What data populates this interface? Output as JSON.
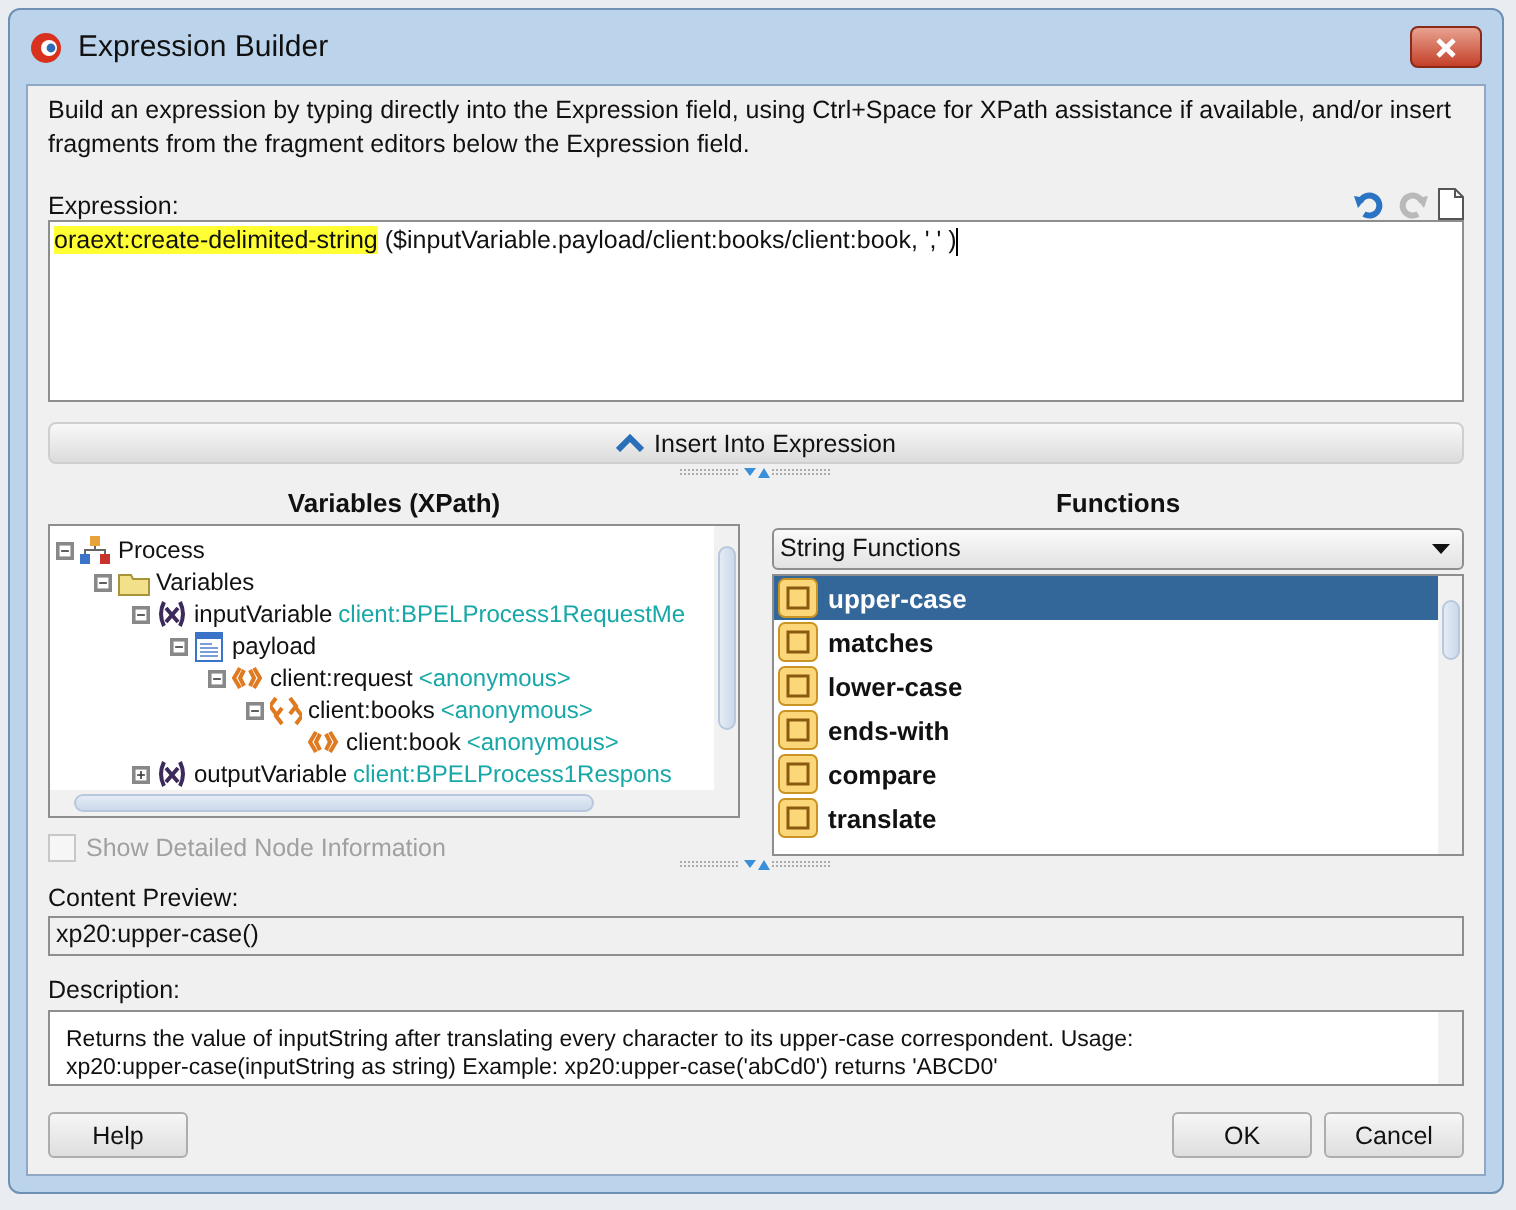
{
  "window": {
    "title": "Expression Builder"
  },
  "intro": "Build an expression by typing directly into the Expression field, using Ctrl+Space for XPath assistance if available, and/or insert fragments from the fragment editors below the Expression field.",
  "expression": {
    "label": "Expression:",
    "segments": [
      {
        "text": "oraext:create-delimited-string",
        "highlighted": true
      },
      {
        "text": " ($inputVariable.payload/client:books/client:book, ',' )",
        "highlighted": false
      }
    ]
  },
  "insert_button": "Insert Into Expression",
  "variables": {
    "title": "Variables (XPath)",
    "tree": [
      {
        "label": "Process",
        "kind": "process",
        "expanded": true,
        "children": [
          {
            "label": "Variables",
            "kind": "folder",
            "expanded": true,
            "children": [
              {
                "label": "inputVariable",
                "type": "client:BPELProcess1RequestMe",
                "kind": "variable",
                "expanded": true,
                "children": [
                  {
                    "label": "payload",
                    "kind": "part",
                    "expanded": true,
                    "children": [
                      {
                        "label": "client:request",
                        "type": "<anonymous>",
                        "kind": "element",
                        "expanded": true,
                        "children": [
                          {
                            "label": "client:books",
                            "type": "<anonymous>",
                            "kind": "elements",
                            "expanded": true,
                            "children": [
                              {
                                "label": "client:book",
                                "type": "<anonymous>",
                                "kind": "element"
                              }
                            ]
                          }
                        ]
                      }
                    ]
                  }
                ]
              },
              {
                "label": "outputVariable",
                "type": "client:BPELProcess1Respons",
                "kind": "variable",
                "expanded": false
              }
            ]
          }
        ]
      }
    ],
    "show_detail": {
      "label": "Show Detailed Node Information",
      "checked": false,
      "disabled": true
    }
  },
  "functions": {
    "title": "Functions",
    "category": "String Functions",
    "items": [
      {
        "label": "upper-case",
        "selected": true
      },
      {
        "label": "matches",
        "selected": false
      },
      {
        "label": "lower-case",
        "selected": false
      },
      {
        "label": "ends-with",
        "selected": false
      },
      {
        "label": "compare",
        "selected": false
      },
      {
        "label": "translate",
        "selected": false
      }
    ]
  },
  "content_preview": {
    "label": "Content Preview:",
    "value": "xp20:upper-case()"
  },
  "description": {
    "label": "Description:",
    "lines": [
      "Returns the value of inputString after translating every character to its upper-case correspondent. Usage:",
      "xp20:upper-case(inputString as string) Example: xp20:upper-case('abCd0') returns 'ABCD0'"
    ]
  },
  "buttons": {
    "help": "Help",
    "ok": "OK",
    "cancel": "Cancel"
  }
}
